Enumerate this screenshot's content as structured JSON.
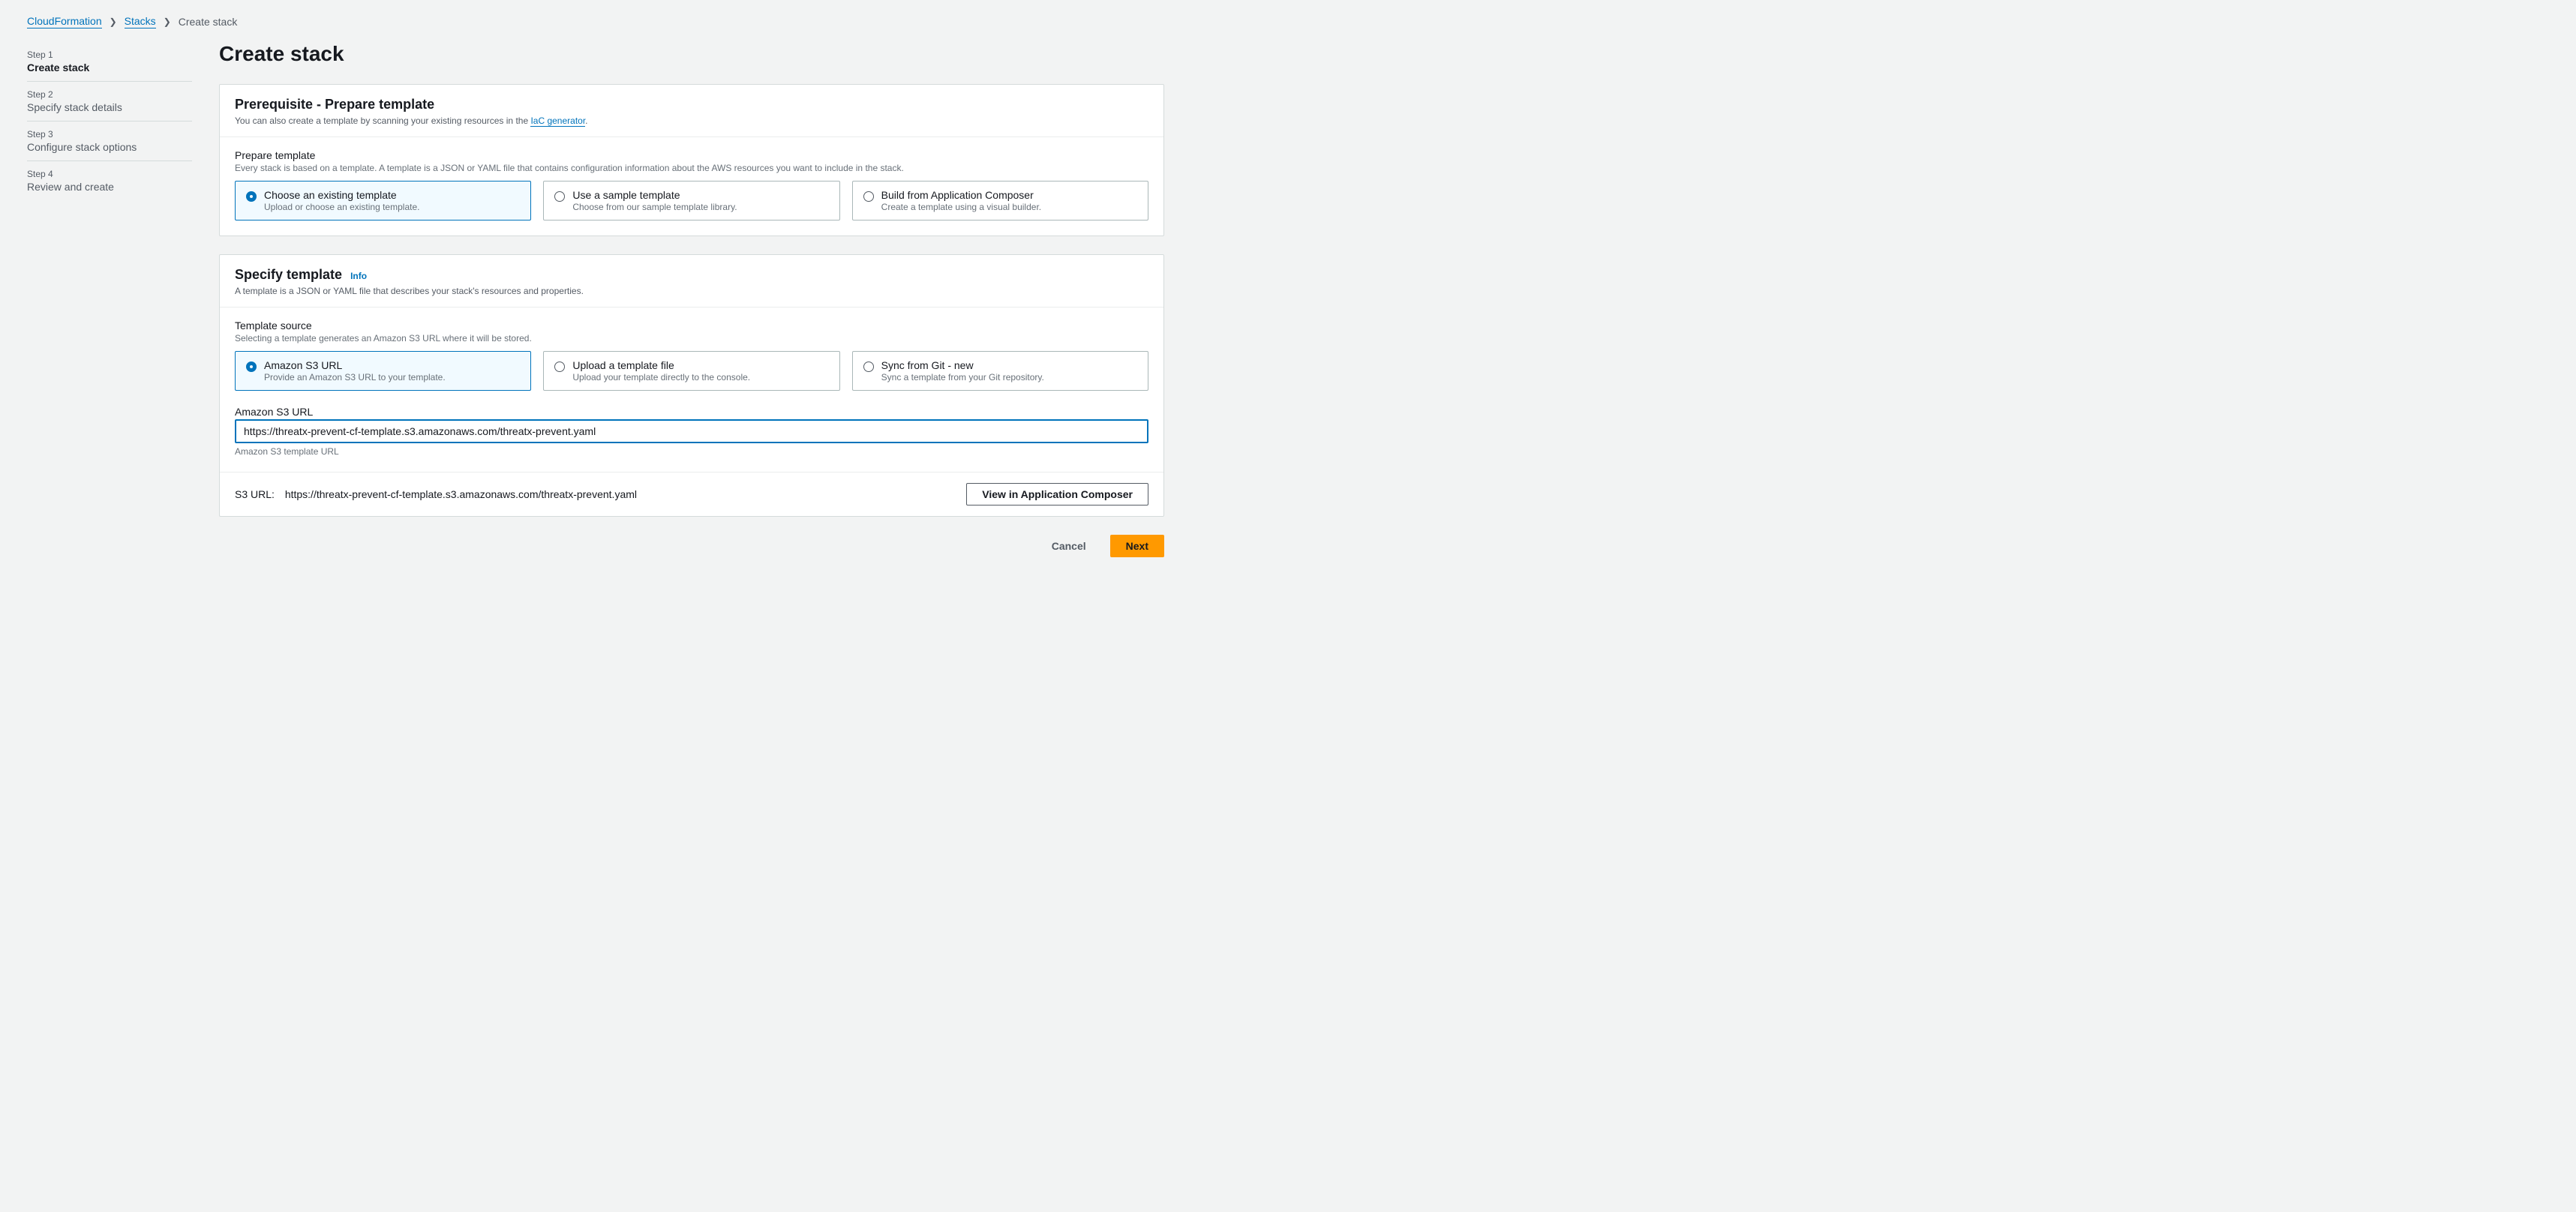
{
  "breadcrumb": {
    "root": "CloudFormation",
    "stacks": "Stacks",
    "current": "Create stack"
  },
  "steps": [
    {
      "label": "Step 1",
      "title": "Create stack",
      "active": true
    },
    {
      "label": "Step 2",
      "title": "Specify stack details",
      "active": false
    },
    {
      "label": "Step 3",
      "title": "Configure stack options",
      "active": false
    },
    {
      "label": "Step 4",
      "title": "Review and create",
      "active": false
    }
  ],
  "page": {
    "title": "Create stack"
  },
  "prereq": {
    "title": "Prerequisite - Prepare template",
    "subtitle_prefix": "You can also create a template by scanning your existing resources in the ",
    "link": "IaC generator",
    "subtitle_suffix": ".",
    "field_label": "Prepare template",
    "field_desc": "Every stack is based on a template. A template is a JSON or YAML file that contains configuration information about the AWS resources you want to include in the stack.",
    "options": [
      {
        "label": "Choose an existing template",
        "sub": "Upload or choose an existing template."
      },
      {
        "label": "Use a sample template",
        "sub": "Choose from our sample template library."
      },
      {
        "label": "Build from Application Composer",
        "sub": "Create a template using a visual builder."
      }
    ]
  },
  "specify": {
    "title": "Specify template",
    "info": "Info",
    "subtitle": "A template is a JSON or YAML file that describes your stack's resources and properties.",
    "source_label": "Template source",
    "source_desc": "Selecting a template generates an Amazon S3 URL where it will be stored.",
    "options": [
      {
        "label": "Amazon S3 URL",
        "sub": "Provide an Amazon S3 URL to your template."
      },
      {
        "label": "Upload a template file",
        "sub": "Upload your template directly to the console."
      },
      {
        "label": "Sync from Git",
        "new": " - new",
        "sub": "Sync a template from your Git repository."
      }
    ],
    "url_label": "Amazon S3 URL",
    "url_value": "https://threatx-prevent-cf-template.s3.amazonaws.com/threatx-prevent.yaml",
    "url_hint": "Amazon S3 template URL",
    "footer_label": "S3 URL:",
    "footer_value": "https://threatx-prevent-cf-template.s3.amazonaws.com/threatx-prevent.yaml",
    "view_button": "View in Application Composer"
  },
  "actions": {
    "cancel": "Cancel",
    "next": "Next"
  }
}
